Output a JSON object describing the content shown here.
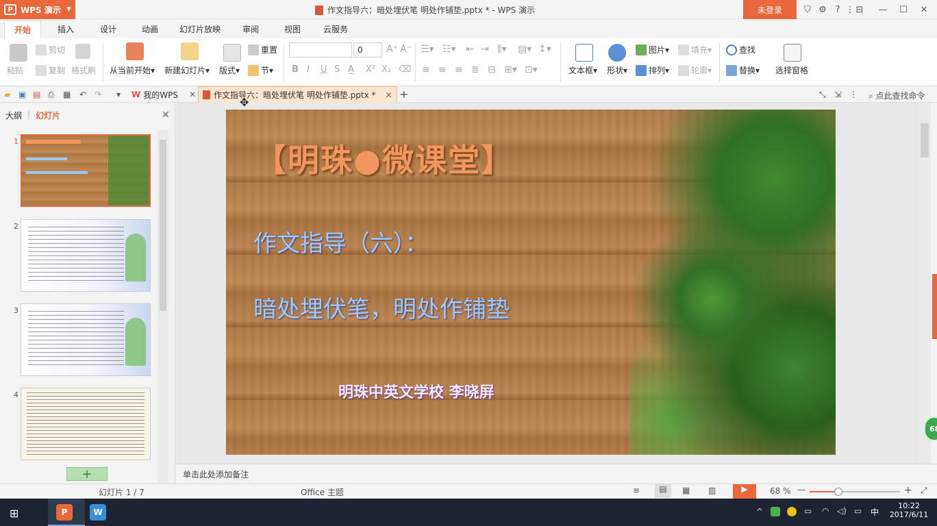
{
  "app": {
    "name": "WPS 演示",
    "window_title": "作文指导六：暗处埋伏笔 明处作铺垫.pptx * - WPS 演示",
    "login": "未登录"
  },
  "menu": {
    "tabs": [
      "开始",
      "插入",
      "设计",
      "动画",
      "幻灯片放映",
      "审阅",
      "视图",
      "云服务"
    ],
    "active": "开始"
  },
  "ribbon": {
    "paste": "粘贴",
    "cut": "剪切",
    "copy": "复制",
    "format_painter": "格式刷",
    "from_current": "从当前开始",
    "new_slide": "新建幻灯片",
    "layout": "版式",
    "reset": "重置",
    "section": "节",
    "font_size": "0",
    "textbox": "文本框",
    "shape": "形状",
    "picture": "图片",
    "fill": "填充",
    "arrange": "排列",
    "outline": "轮廓",
    "find": "查找",
    "replace": "替换",
    "selection_pane": "选择窗格"
  },
  "quickbar": {
    "my_wps": "我的WPS",
    "doc_tab": "作文指导六：暗处埋伏笔 明处作铺垫.pptx *",
    "search_cmd": "点此查找命令"
  },
  "left_panel": {
    "tab_outline": "大纲",
    "tab_slides": "幻灯片",
    "thumbs": [
      {
        "num": "1",
        "selected": true
      },
      {
        "num": "2",
        "selected": false
      },
      {
        "num": "3",
        "selected": false
      },
      {
        "num": "4",
        "selected": false
      }
    ]
  },
  "slide": {
    "title": "【明珠●微课堂】",
    "line1": "作文指导（六）：",
    "line2": "暗处埋伏笔，明处作铺垫",
    "author": "明珠中英文学校 李晓屏"
  },
  "notes": {
    "placeholder": "单击此处添加备注"
  },
  "status": {
    "slide_count": "幻灯片 1 / 7",
    "theme": "Office 主题",
    "zoom": "68 %"
  },
  "float_badge": "68",
  "taskbar": {
    "time": "10:22",
    "date": "2017/6/11",
    "ime": "中"
  },
  "colors": {
    "accent": "#e9673a",
    "slide_title": "#f0975f",
    "slide_text": "#9ec9ff"
  }
}
